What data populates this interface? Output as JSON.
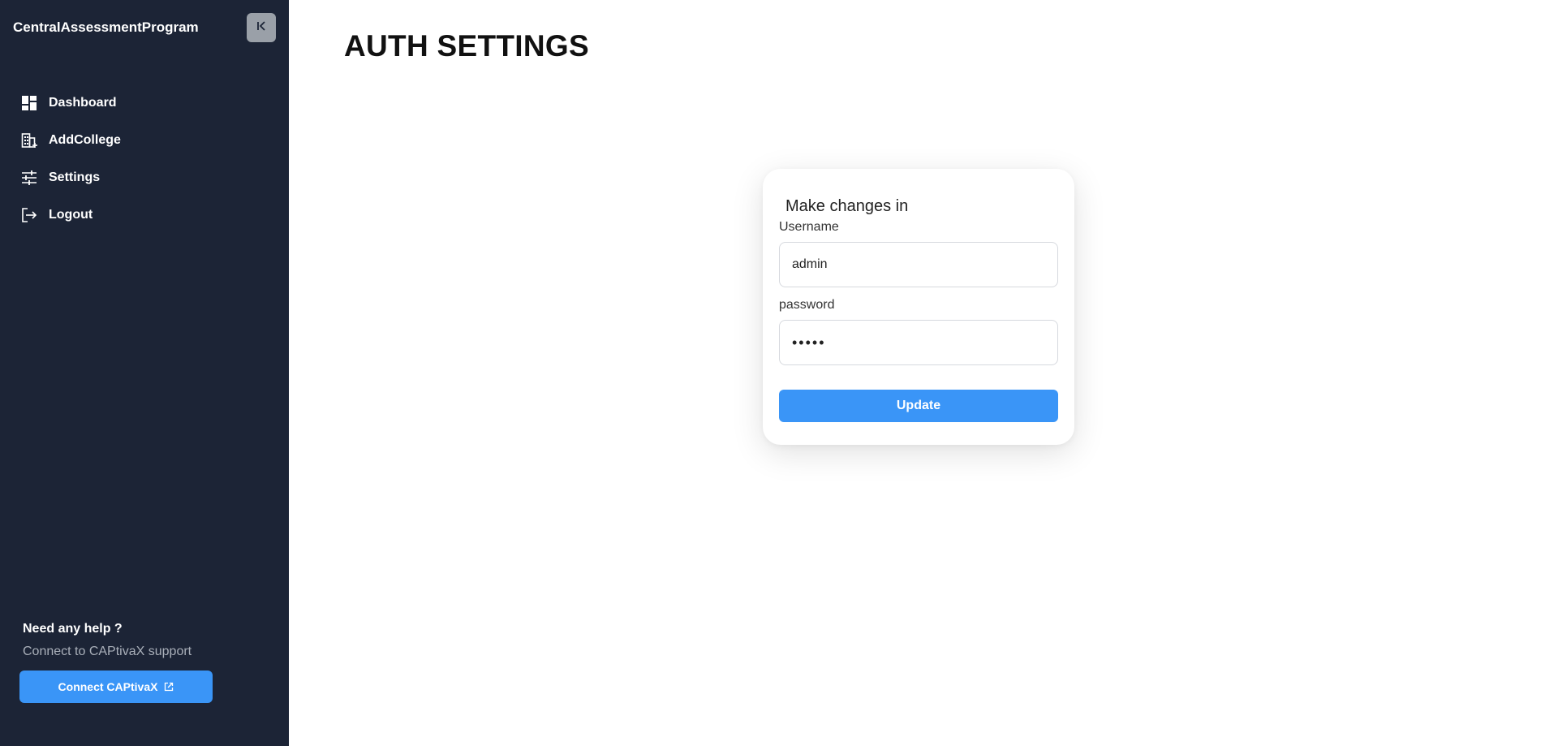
{
  "sidebar": {
    "brand": "CentralAssessmentProgram",
    "collapse_icon": "collapse-left-icon",
    "items": [
      {
        "label": "Dashboard",
        "icon": "dashboard-icon"
      },
      {
        "label": "AddCollege",
        "icon": "building-add-icon"
      },
      {
        "label": "Settings",
        "icon": "sliders-icon"
      },
      {
        "label": "Logout",
        "icon": "logout-icon"
      }
    ],
    "help": {
      "title": "Need any help ?",
      "subtitle": "Connect to CAPtivaX support",
      "button_label": "Connect CAPtivaX",
      "button_icon": "external-link-icon"
    }
  },
  "main": {
    "title": "AUTH SETTINGS",
    "form": {
      "heading": "Make changes in",
      "username_label": "Username",
      "username_value": "admin",
      "password_label": "password",
      "password_value": "•••••",
      "submit_label": "Update"
    }
  },
  "colors": {
    "sidebar_bg": "#1c2436",
    "accent": "#3a95f7",
    "collapse_btn_bg": "#9aa0a8"
  }
}
